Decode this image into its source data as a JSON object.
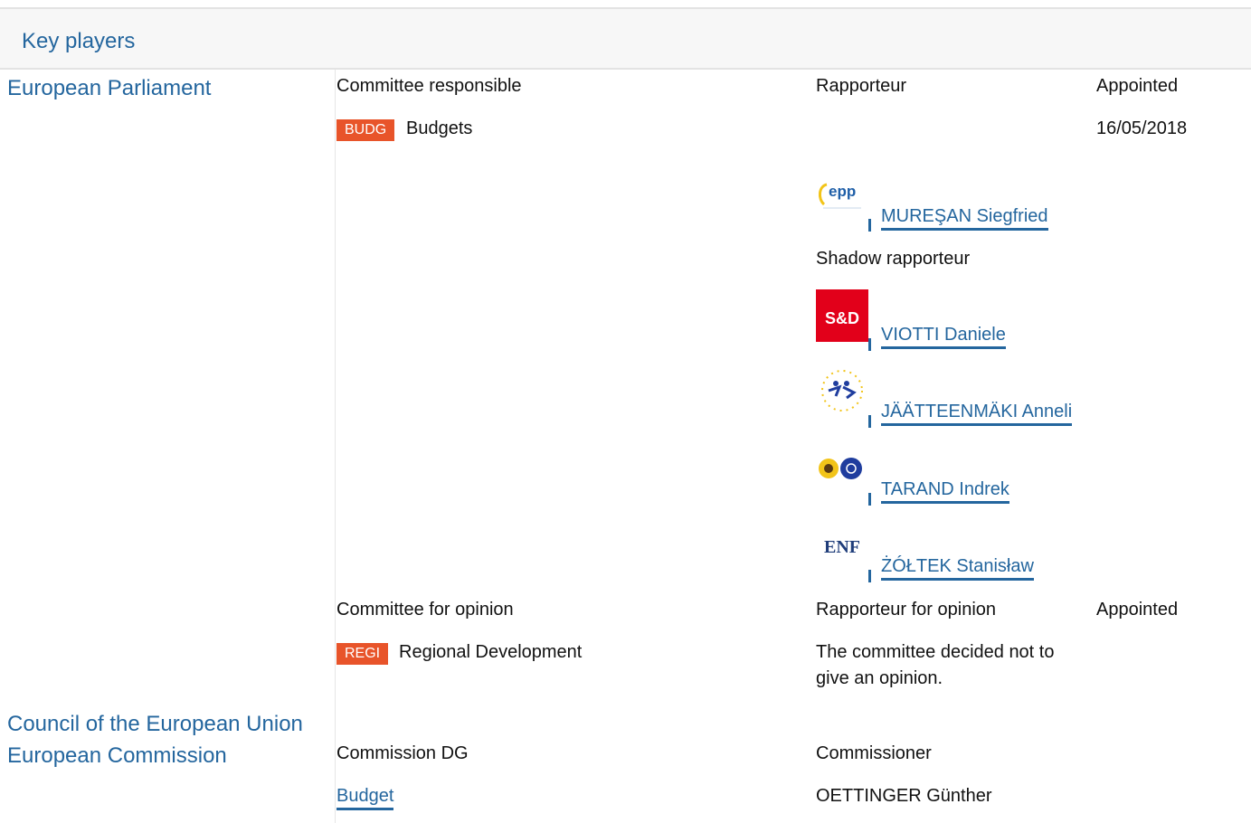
{
  "header": {
    "title": "Key players"
  },
  "institutions": {
    "ep": "European Parliament",
    "council": "Council of the European Union",
    "commission": "European Commission"
  },
  "parliament": {
    "committee_header": "Committee responsible",
    "rapporteur_header": "Rapporteur",
    "appointed_header": "Appointed",
    "committee": {
      "abbr": "BUDG",
      "name": "Budgets",
      "appointed": "16/05/2018"
    },
    "rapporteur": {
      "group": "epp-logo",
      "name": "MUREŞAN Siegfried"
    },
    "shadow_header": "Shadow rapporteur",
    "shadows": [
      {
        "group": "sd-logo",
        "logo_text": "S&D",
        "name": "VIOTTI Daniele"
      },
      {
        "group": "alde-logo",
        "name": "JÄÄTTEENMÄKI Anneli"
      },
      {
        "group": "greens-efa-logo",
        "name": "TARAND Indrek"
      },
      {
        "group": "enf-logo",
        "logo_text": "ENF",
        "name": "ŻÓŁTEK Stanisław"
      }
    ],
    "opinion": {
      "committee_header": "Committee for opinion",
      "rapporteur_header": "Rapporteur for opinion",
      "appointed_header": "Appointed",
      "abbr": "REGI",
      "name": "Regional Development",
      "note_line1": "The committee decided not to",
      "note_line2": "give an opinion."
    }
  },
  "commission": {
    "dg_header": "Commission DG",
    "commissioner_header": "Commissioner",
    "dg": "Budget",
    "commissioner": "OETTINGER Günther"
  },
  "colors": {
    "link": "#24669e",
    "badge": "#e8542a"
  }
}
